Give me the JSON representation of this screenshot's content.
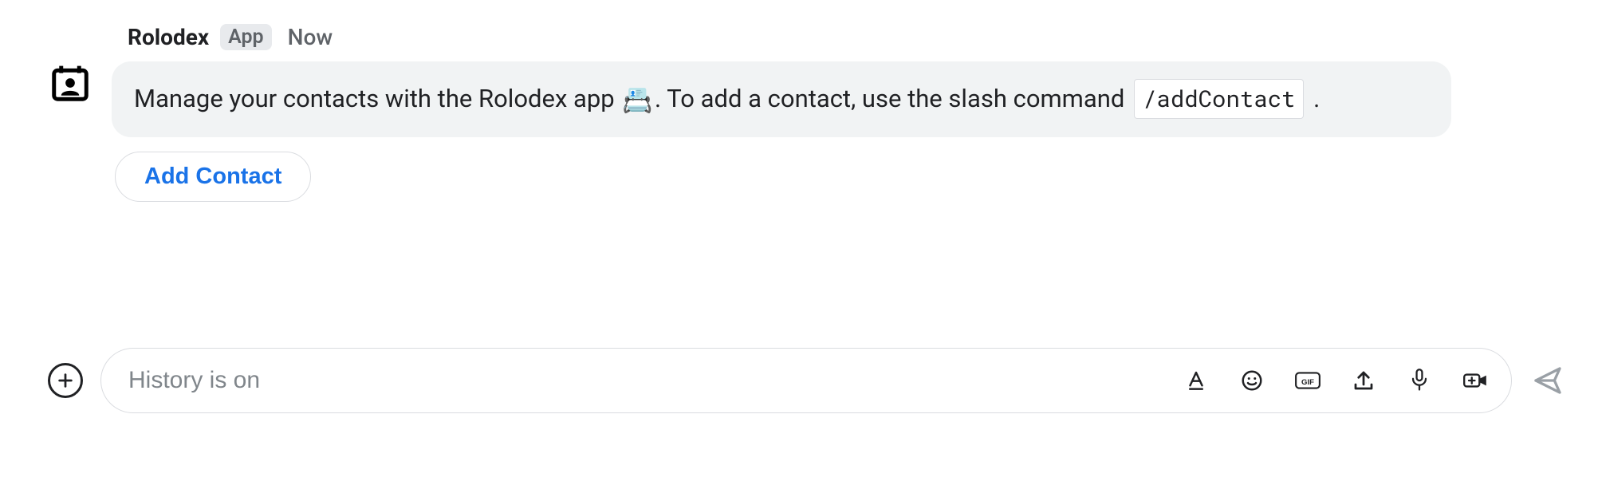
{
  "message": {
    "sender": "Rolodex",
    "badge": "App",
    "time": "Now",
    "text_part1": "Manage your contacts with the Rolodex app ",
    "emoji": "📇",
    "text_part2": ". To add a contact, use the slash command ",
    "code": "/addContact",
    "text_part3": " .",
    "action_label": "Add Contact"
  },
  "compose": {
    "placeholder": "History is on"
  }
}
